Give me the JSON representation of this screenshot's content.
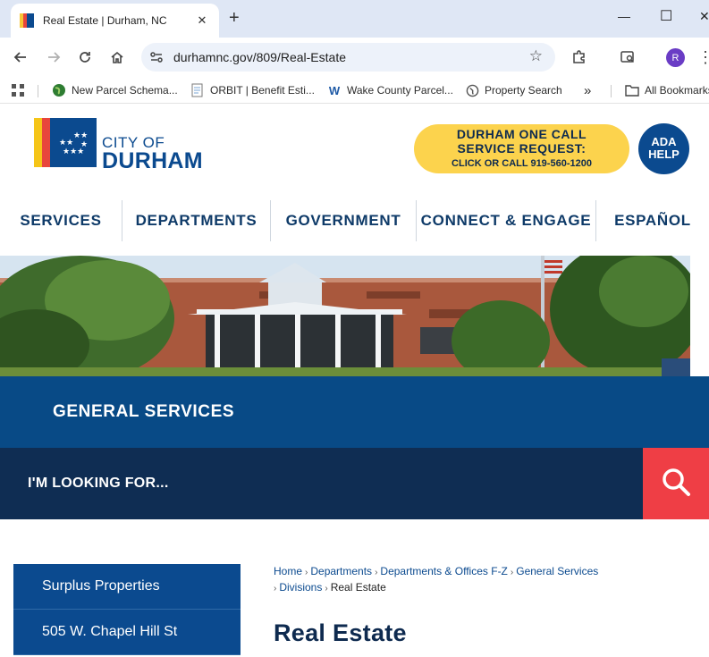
{
  "browser": {
    "tab_title": "Real Estate | Durham, NC",
    "url": "durhamnc.gov/809/Real-Estate",
    "profile_initial": "R",
    "bookmarks": [
      "New Parcel Schema...",
      "ORBIT | Benefit Esti...",
      "Wake County Parcel...",
      "Property Search"
    ],
    "all_bookmarks": "All Bookmarks"
  },
  "site": {
    "logo_line1": "CITY OF",
    "logo_line2": "DURHAM",
    "one_call": {
      "line1": "DURHAM ONE CALL",
      "line2": "SERVICE REQUEST:",
      "line3": "CLICK OR CALL 919-560-1200"
    },
    "ada": {
      "line1": "ADA",
      "line2": "HELP"
    },
    "nav": [
      "SERVICES",
      "DEPARTMENTS",
      "GOVERNMENT",
      "CONNECT & ENGAGE",
      "ESPAÑOL"
    ],
    "section_title": "GENERAL SERVICES",
    "search_label": "I'M LOOKING FOR...",
    "sidebar": [
      "Surplus Properties",
      "505 W. Chapel Hill St"
    ],
    "breadcrumb": [
      "Home",
      "Departments",
      "Departments & Offices F-Z",
      "General Services",
      "Divisions",
      "Real Estate"
    ],
    "page_title": "Real Estate"
  },
  "colors": {
    "brand_blue": "#0b4a8f",
    "navy": "#0f2d53",
    "accent_red": "#ef3e45",
    "accent_yellow": "#fcd34d"
  }
}
